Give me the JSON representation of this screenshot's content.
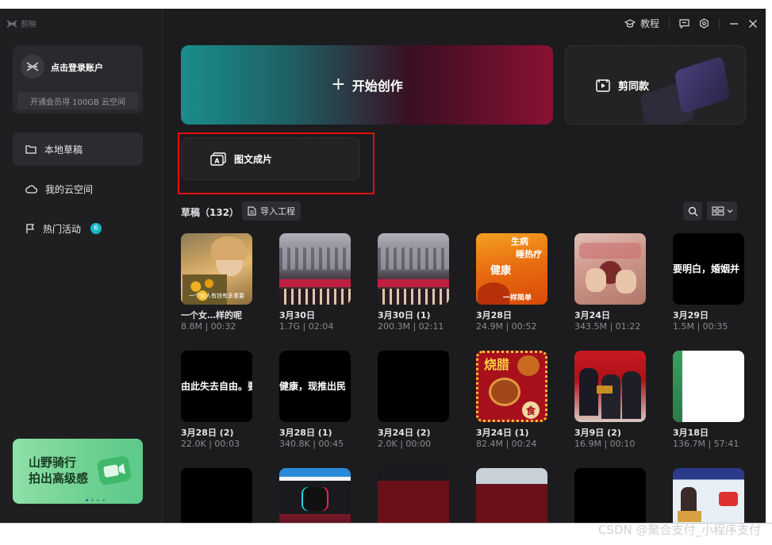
{
  "app": {
    "logo_text": "剪映"
  },
  "account": {
    "login_label": "点击登录账户",
    "vip_text": "开通会员得 100GB 云空间"
  },
  "sidebar": {
    "items": [
      {
        "label": "本地草稿",
        "icon": "folder-icon",
        "active": true
      },
      {
        "label": "我的云空间",
        "icon": "cloud-icon",
        "active": false
      },
      {
        "label": "热门活动",
        "icon": "flag-icon",
        "active": false,
        "badge": "6"
      }
    ]
  },
  "promo": {
    "line1": "山野骑行",
    "line2": "拍出高级感"
  },
  "topbar": {
    "tutorial_label": "教程"
  },
  "actions": {
    "create_label": "开始创作",
    "template_label": "剪同款",
    "image_text_label": "图文成片"
  },
  "drafts": {
    "title": "草稿（132）",
    "import_label": "导入工程",
    "items": [
      {
        "name": "一个女…样的呢",
        "meta": "8.8M | 00:32",
        "caption": "一个女人有钱有多重要"
      },
      {
        "name": "3月30日",
        "meta": "1.7G | 02:04",
        "caption": ""
      },
      {
        "name": "3月30日 (1)",
        "meta": "200.3M | 02:11",
        "caption": ""
      },
      {
        "name": "3月28日",
        "meta": "24.9M | 00:52",
        "caption": ""
      },
      {
        "name": "3月24日",
        "meta": "343.5M | 01:22",
        "caption": ""
      },
      {
        "name": "3月29日",
        "meta": "1.5M | 00:35",
        "caption": "要明白，婚姻并"
      },
      {
        "name": "3月28日 (2)",
        "meta": "22.0K | 00:03",
        "caption": "由此失去自由。要"
      },
      {
        "name": "3月28日 (1)",
        "meta": "340.8K | 00:45",
        "caption": "健康，现推出民"
      },
      {
        "name": "3月24日 (2)",
        "meta": "2.0K | 00:00",
        "caption": ""
      },
      {
        "name": "3月24日 (1)",
        "meta": "82.4M | 00:24",
        "caption": ""
      },
      {
        "name": "3月9日 (2)",
        "meta": "16.9M | 00:10",
        "caption": ""
      },
      {
        "name": "3月18日",
        "meta": "136.7M | 57:41",
        "caption": ""
      },
      {
        "name": "",
        "meta": "",
        "caption": ""
      },
      {
        "name": "",
        "meta": "",
        "caption": ""
      },
      {
        "name": "",
        "meta": "",
        "caption": ""
      },
      {
        "name": "",
        "meta": "",
        "caption": ""
      },
      {
        "name": "",
        "meta": "",
        "caption": ""
      },
      {
        "name": "",
        "meta": "",
        "caption": ""
      }
    ]
  },
  "thumb_texts": {
    "health_words": [
      "生病",
      "睡热疗",
      "健康",
      "一样简单"
    ],
    "food_words": [
      "烧腊",
      "食"
    ]
  },
  "watermark": "CSDN @聚合支付_小程序支付"
}
